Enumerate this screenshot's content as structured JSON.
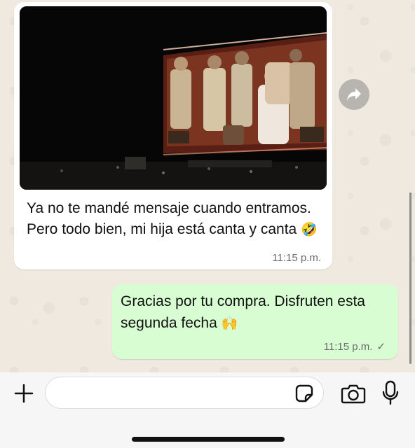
{
  "chat": {
    "incoming": {
      "image_label": "concert-photo",
      "text": "Ya no te mandé mensaje cuando entramos. Pero todo bien, mi hija está canta y canta",
      "emoji": "🤣",
      "time": "11:15 p.m."
    },
    "outgoing": {
      "text": "Gracias por tu compra. Disfruten esta segunda fecha",
      "emoji": "🙌",
      "time": "11:15 p.m.",
      "status": "✓"
    }
  },
  "composer": {
    "input_value": "",
    "placeholder": ""
  },
  "icons": {
    "forward": "forward-arrow-icon",
    "plus": "plus-icon",
    "sticker": "sticker-icon",
    "camera": "camera-icon",
    "mic": "microphone-icon"
  },
  "colors": {
    "incoming_bubble": "#ffffff",
    "outgoing_bubble": "#d9fdd3",
    "wallpaper": "#efe9df",
    "timestamp": "#6b6b6b"
  }
}
